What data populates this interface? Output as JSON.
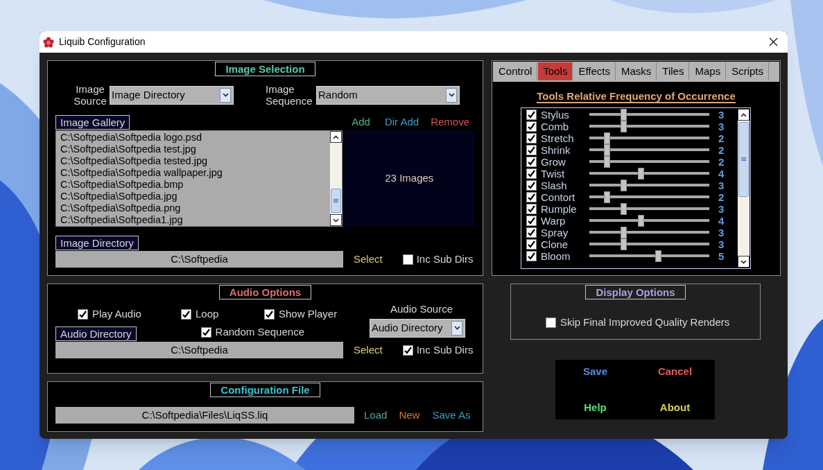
{
  "window": {
    "title": "Liquib Configuration"
  },
  "image_selection": {
    "title": "Image Selection",
    "source_label": "Image Source",
    "source_value": "Image Directory",
    "sequence_label": "Image Sequence",
    "sequence_value": "Random",
    "gallery_label": "Image Gallery",
    "gallery_actions": [
      {
        "label": "Add",
        "color": "#4fb08f"
      },
      {
        "label": "Dir Add",
        "color": "#3a9fc0"
      },
      {
        "label": "Remove",
        "color": "#d05555"
      }
    ],
    "gallery_items": [
      "C:\\Softpedia\\Softpedia logo.psd",
      "C:\\Softpedia\\Softpedia test.jpg",
      "C:\\Softpedia\\Softpedia tested.jpg",
      "C:\\Softpedia\\Softpedia wallpaper.jpg",
      "C:\\Softpedia\\Softpedia.bmp",
      "C:\\Softpedia\\Softpedia.jpg",
      "C:\\Softpedia\\Softpedia.png",
      "C:\\Softpedia\\Softpedia1.jpg"
    ],
    "image_count": "23 Images",
    "directory_label": "Image Directory",
    "directory_value": "C:\\Softpedia",
    "select": "Select",
    "inc_sub_dirs": {
      "label": "Inc Sub Dirs",
      "checked": false
    }
  },
  "audio_options": {
    "title": "Audio Options",
    "options": [
      {
        "label": "Play Audio",
        "checked": true
      },
      {
        "label": "Loop",
        "checked": true
      },
      {
        "label": "Show Player",
        "checked": true
      }
    ],
    "random_sequence": {
      "label": "Random Sequence",
      "checked": true
    },
    "source_label": "Audio Source",
    "source_value": "Audio Directory",
    "directory_label": "Audio Directory",
    "directory_value": "C:\\Softpedia",
    "select": "Select",
    "inc_sub_dirs": {
      "label": "Inc Sub Dirs",
      "checked": true
    }
  },
  "configuration_file": {
    "title": "Configuration File",
    "path": "C:\\Softpedia\\Files\\LiqSS.liq",
    "actions": [
      {
        "label": "Load",
        "color": "#4fa8a0"
      },
      {
        "label": "New",
        "color": "#d87a3a"
      },
      {
        "label": "Save As",
        "color": "#3a9fc0"
      }
    ]
  },
  "tabs": [
    {
      "label": "Control",
      "selected": false
    },
    {
      "label": "Tools",
      "selected": true
    },
    {
      "label": "Effects",
      "selected": false
    },
    {
      "label": "Masks",
      "selected": false
    },
    {
      "label": "Tiles",
      "selected": false
    },
    {
      "label": "Maps",
      "selected": false
    },
    {
      "label": "Scripts",
      "selected": false
    }
  ],
  "tools": {
    "heading": "Tools Relative Frequency of Occurrence",
    "rows": [
      {
        "name": "Stylus",
        "checked": true,
        "level": 0.286,
        "value": "3"
      },
      {
        "name": "Comb",
        "checked": true,
        "level": 0.286,
        "value": "3"
      },
      {
        "name": "Stretch",
        "checked": true,
        "level": 0.143,
        "value": "2"
      },
      {
        "name": "Shrink",
        "checked": true,
        "level": 0.143,
        "value": "2"
      },
      {
        "name": "Grow",
        "checked": true,
        "level": 0.143,
        "value": "2"
      },
      {
        "name": "Twist",
        "checked": true,
        "level": 0.429,
        "value": "4"
      },
      {
        "name": "Slash",
        "checked": true,
        "level": 0.286,
        "value": "3"
      },
      {
        "name": "Contort",
        "checked": true,
        "level": 0.143,
        "value": "2"
      },
      {
        "name": "Rumple",
        "checked": true,
        "level": 0.286,
        "value": "3"
      },
      {
        "name": "Warp",
        "checked": true,
        "level": 0.429,
        "value": "4"
      },
      {
        "name": "Spray",
        "checked": true,
        "level": 0.286,
        "value": "3"
      },
      {
        "name": "Clone",
        "checked": true,
        "level": 0.286,
        "value": "3"
      },
      {
        "name": "Bloom",
        "checked": true,
        "level": 0.571,
        "value": "5"
      }
    ]
  },
  "display_options": {
    "title": "Display Options",
    "skip_final": {
      "label": "Skip Final Improved Quality Renders",
      "checked": false
    }
  },
  "buttons": [
    {
      "label": "Save",
      "color": "#5a8ae0"
    },
    {
      "label": "Cancel",
      "color": "#e05a5a"
    },
    {
      "label": "Help",
      "color": "#5ae07a"
    },
    {
      "label": "About",
      "color": "#d8d050"
    }
  ]
}
